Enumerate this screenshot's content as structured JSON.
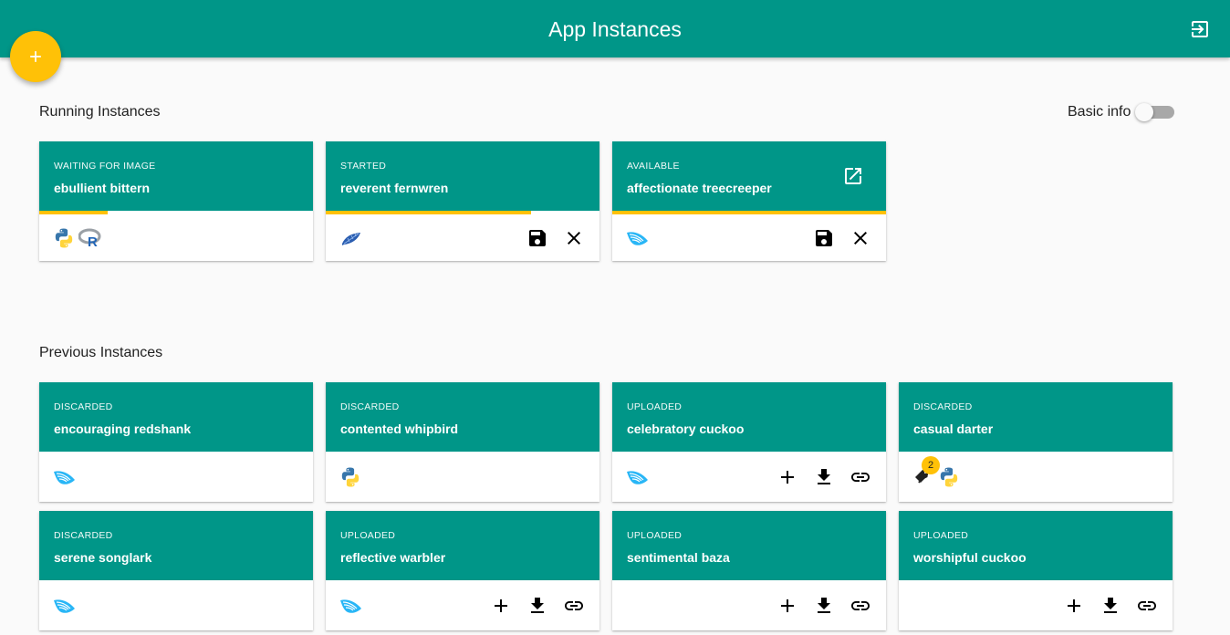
{
  "app": {
    "title": "App Instances",
    "accent": "#009688",
    "fab_color": "#ffc107"
  },
  "running": {
    "title": "Running Instances",
    "basic_info_label": "Basic info",
    "basic_info_on": false,
    "cards": [
      {
        "status": "Waiting for image",
        "name": "ebullient bittern",
        "progress": 0.25,
        "icons": [
          "python-icon",
          "r-icon"
        ],
        "actions": []
      },
      {
        "status": "Started",
        "name": "reverent fernwren",
        "progress": 0.75,
        "icons": [
          "feather-icon"
        ],
        "actions": [
          "save-icon",
          "close-icon"
        ]
      },
      {
        "status": "Available",
        "name": "affectionate treecreeper",
        "progress": 1.0,
        "icons": [
          "wave-app-icon"
        ],
        "actions": [
          "save-icon",
          "close-icon"
        ],
        "open_external": true
      }
    ]
  },
  "previous": {
    "title": "Previous Instances",
    "cards": [
      {
        "status": "Discarded",
        "name": "encouraging redshank",
        "icons": [
          "wave-app-icon"
        ],
        "actions": []
      },
      {
        "status": "Discarded",
        "name": "contented whipbird",
        "icons": [
          "python-icon"
        ],
        "actions": []
      },
      {
        "status": "Uploaded",
        "name": "celebratory cuckoo",
        "icons": [
          "wave-app-icon"
        ],
        "actions": [
          "add-icon",
          "download-icon",
          "link-icon"
        ]
      },
      {
        "status": "Discarded",
        "name": "casual darter",
        "icons": [
          "tags-icon",
          "python-icon"
        ],
        "badge": "2",
        "actions": []
      },
      {
        "status": "Discarded",
        "name": "serene songlark",
        "icons": [
          "wave-app-icon"
        ],
        "actions": []
      },
      {
        "status": "Uploaded",
        "name": "reflective warbler",
        "icons": [
          "wave-app-icon"
        ],
        "actions": [
          "add-icon",
          "download-icon",
          "link-icon"
        ]
      },
      {
        "status": "Uploaded",
        "name": "sentimental baza",
        "icons": [],
        "actions": [
          "add-icon",
          "download-icon",
          "link-icon"
        ]
      },
      {
        "status": "Uploaded",
        "name": "worshipful cuckoo",
        "icons": [],
        "actions": [
          "add-icon",
          "download-icon",
          "link-icon"
        ]
      }
    ]
  }
}
